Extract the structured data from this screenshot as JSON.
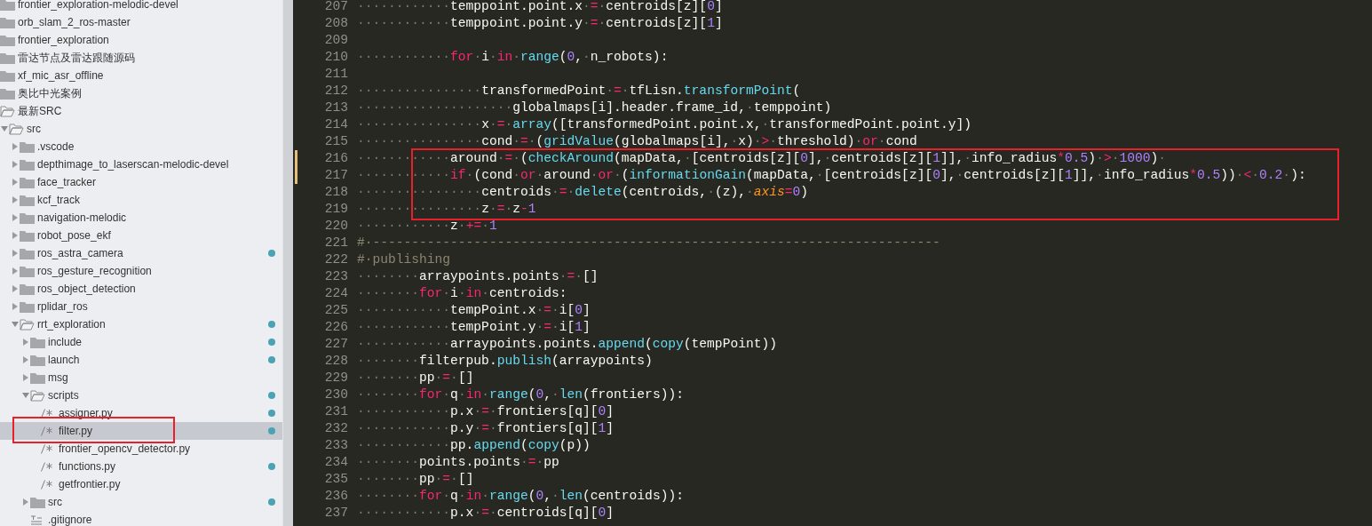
{
  "sidebar": {
    "items": [
      {
        "label": "frontier_exploration-melodic-devel",
        "kind": "folder",
        "expanded": false,
        "selected": false,
        "modified": false,
        "highlighted": false
      },
      {
        "label": "orb_slam_2_ros-master",
        "kind": "folder",
        "expanded": false,
        "selected": false,
        "modified": false,
        "highlighted": false
      },
      {
        "label": "frontier_exploration",
        "kind": "folder",
        "expanded": false,
        "selected": false,
        "modified": false,
        "highlighted": false
      },
      {
        "label": "雷达节点及雷达跟随源码",
        "kind": "folder",
        "expanded": false,
        "selected": false,
        "modified": false,
        "highlighted": false
      },
      {
        "label": "xf_mic_asr_offline",
        "kind": "folder",
        "expanded": false,
        "selected": false,
        "modified": false,
        "highlighted": false
      },
      {
        "label": "奥比中光案例",
        "kind": "folder",
        "expanded": false,
        "selected": false,
        "modified": false,
        "highlighted": false
      },
      {
        "label": "最新SRC",
        "kind": "folder",
        "expanded": true,
        "selected": false,
        "modified": false,
        "highlighted": false,
        "children": [
          {
            "label": "src",
            "kind": "folder",
            "expanded": true,
            "selected": false,
            "modified": false,
            "highlighted": false,
            "children": [
              {
                "label": ".vscode",
                "kind": "folder",
                "expanded": false,
                "selected": false,
                "modified": false,
                "highlighted": false
              },
              {
                "label": "depthimage_to_laserscan-melodic-devel",
                "kind": "folder",
                "expanded": false,
                "selected": false,
                "modified": false,
                "highlighted": false
              },
              {
                "label": "face_tracker",
                "kind": "folder",
                "expanded": false,
                "selected": false,
                "modified": false,
                "highlighted": false
              },
              {
                "label": "kcf_track",
                "kind": "folder",
                "expanded": false,
                "selected": false,
                "modified": false,
                "highlighted": false
              },
              {
                "label": "navigation-melodic",
                "kind": "folder",
                "expanded": false,
                "selected": false,
                "modified": false,
                "highlighted": false
              },
              {
                "label": "robot_pose_ekf",
                "kind": "folder",
                "expanded": false,
                "selected": false,
                "modified": false,
                "highlighted": false
              },
              {
                "label": "ros_astra_camera",
                "kind": "folder",
                "expanded": false,
                "selected": false,
                "modified": true,
                "highlighted": false
              },
              {
                "label": "ros_gesture_recognition",
                "kind": "folder",
                "expanded": false,
                "selected": false,
                "modified": false,
                "highlighted": false
              },
              {
                "label": "ros_object_detection",
                "kind": "folder",
                "expanded": false,
                "selected": false,
                "modified": false,
                "highlighted": false
              },
              {
                "label": "rplidar_ros",
                "kind": "folder",
                "expanded": false,
                "selected": false,
                "modified": false,
                "highlighted": false
              },
              {
                "label": "rrt_exploration",
                "kind": "folder",
                "expanded": true,
                "selected": false,
                "modified": true,
                "highlighted": false,
                "children": [
                  {
                    "label": "include",
                    "kind": "folder",
                    "expanded": false,
                    "selected": false,
                    "modified": true,
                    "highlighted": false
                  },
                  {
                    "label": "launch",
                    "kind": "folder",
                    "expanded": false,
                    "selected": false,
                    "modified": true,
                    "highlighted": false
                  },
                  {
                    "label": "msg",
                    "kind": "folder",
                    "expanded": false,
                    "selected": false,
                    "modified": false,
                    "highlighted": false
                  },
                  {
                    "label": "scripts",
                    "kind": "folder",
                    "expanded": true,
                    "selected": false,
                    "modified": true,
                    "highlighted": false,
                    "children": [
                      {
                        "label": "assigner.py",
                        "kind": "code",
                        "selected": false,
                        "modified": true,
                        "highlighted": false
                      },
                      {
                        "label": "filter.py",
                        "kind": "code",
                        "selected": true,
                        "modified": true,
                        "highlighted": true
                      },
                      {
                        "label": "frontier_opencv_detector.py",
                        "kind": "code",
                        "selected": false,
                        "modified": false,
                        "highlighted": false
                      },
                      {
                        "label": "functions.py",
                        "kind": "code",
                        "selected": false,
                        "modified": true,
                        "highlighted": false
                      },
                      {
                        "label": "getfrontier.py",
                        "kind": "code",
                        "selected": false,
                        "modified": false,
                        "highlighted": false
                      }
                    ]
                  },
                  {
                    "label": "src",
                    "kind": "folder",
                    "expanded": false,
                    "selected": false,
                    "modified": true,
                    "highlighted": false
                  },
                  {
                    "label": ".gitignore",
                    "kind": "text",
                    "selected": false,
                    "modified": false,
                    "highlighted": false
                  }
                ]
              }
            ]
          }
        ]
      }
    ]
  },
  "editor": {
    "lines": [
      {
        "number": "207",
        "modified": false,
        "highlighted": false,
        "tokens": [
          {
            "kind": "ws",
            "text": "············"
          },
          {
            "kind": "plain",
            "text": "temppoint.point.x"
          },
          {
            "kind": "ws",
            "text": "·"
          },
          {
            "kind": "kw",
            "text": "="
          },
          {
            "kind": "ws",
            "text": "·"
          },
          {
            "kind": "plain",
            "text": "centroids[z]["
          },
          {
            "kind": "num",
            "text": "0"
          },
          {
            "kind": "plain",
            "text": "]"
          }
        ]
      },
      {
        "number": "208",
        "modified": false,
        "highlighted": false,
        "tokens": [
          {
            "kind": "ws",
            "text": "············"
          },
          {
            "kind": "plain",
            "text": "temppoint.point.y"
          },
          {
            "kind": "ws",
            "text": "·"
          },
          {
            "kind": "kw",
            "text": "="
          },
          {
            "kind": "ws",
            "text": "·"
          },
          {
            "kind": "plain",
            "text": "centroids[z]["
          },
          {
            "kind": "num",
            "text": "1"
          },
          {
            "kind": "plain",
            "text": "]"
          }
        ]
      },
      {
        "number": "209",
        "modified": false,
        "highlighted": false
      },
      {
        "number": "210",
        "modified": false,
        "highlighted": false,
        "tokens": [
          {
            "kind": "ws",
            "text": "············"
          },
          {
            "kind": "kw",
            "text": "for"
          },
          {
            "kind": "ws",
            "text": "·"
          },
          {
            "kind": "plain",
            "text": "i"
          },
          {
            "kind": "ws",
            "text": "·"
          },
          {
            "kind": "kw",
            "text": "in"
          },
          {
            "kind": "ws",
            "text": "·"
          },
          {
            "kind": "fn",
            "text": "range"
          },
          {
            "kind": "plain",
            "text": "("
          },
          {
            "kind": "num",
            "text": "0"
          },
          {
            "kind": "plain",
            "text": ","
          },
          {
            "kind": "ws",
            "text": "·"
          },
          {
            "kind": "plain",
            "text": "n_robots):"
          }
        ]
      },
      {
        "number": "211",
        "modified": false,
        "highlighted": false
      },
      {
        "number": "212",
        "modified": false,
        "highlighted": false,
        "tokens": [
          {
            "kind": "ws",
            "text": "················"
          },
          {
            "kind": "plain",
            "text": "transformedPoint"
          },
          {
            "kind": "ws",
            "text": "·"
          },
          {
            "kind": "kw",
            "text": "="
          },
          {
            "kind": "ws",
            "text": "·"
          },
          {
            "kind": "plain",
            "text": "tfLisn."
          },
          {
            "kind": "fn",
            "text": "transformPoint"
          },
          {
            "kind": "plain",
            "text": "("
          }
        ]
      },
      {
        "number": "213",
        "modified": false,
        "highlighted": false,
        "tokens": [
          {
            "kind": "ws",
            "text": "····················"
          },
          {
            "kind": "plain",
            "text": "globalmaps[i].header.frame_id,"
          },
          {
            "kind": "ws",
            "text": "·"
          },
          {
            "kind": "plain",
            "text": "temppoint)"
          }
        ]
      },
      {
        "number": "214",
        "modified": false,
        "highlighted": false,
        "tokens": [
          {
            "kind": "ws",
            "text": "················"
          },
          {
            "kind": "plain",
            "text": "x"
          },
          {
            "kind": "ws",
            "text": "·"
          },
          {
            "kind": "kw",
            "text": "="
          },
          {
            "kind": "ws",
            "text": "·"
          },
          {
            "kind": "fn",
            "text": "array"
          },
          {
            "kind": "plain",
            "text": "([transformedPoint.point.x,"
          },
          {
            "kind": "ws",
            "text": "·"
          },
          {
            "kind": "plain",
            "text": "transformedPoint.point.y])"
          }
        ]
      },
      {
        "number": "215",
        "modified": false,
        "highlighted": false,
        "tokens": [
          {
            "kind": "ws",
            "text": "················"
          },
          {
            "kind": "plain",
            "text": "cond"
          },
          {
            "kind": "ws",
            "text": "·"
          },
          {
            "kind": "kw",
            "text": "="
          },
          {
            "kind": "ws",
            "text": "·"
          },
          {
            "kind": "plain",
            "text": "("
          },
          {
            "kind": "fn",
            "text": "gridValue"
          },
          {
            "kind": "plain",
            "text": "(globalmaps[i],"
          },
          {
            "kind": "ws",
            "text": "·"
          },
          {
            "kind": "plain",
            "text": "x)"
          },
          {
            "kind": "ws",
            "text": "·"
          },
          {
            "kind": "kw",
            "text": ">"
          },
          {
            "kind": "ws",
            "text": "·"
          },
          {
            "kind": "plain",
            "text": "threshold)"
          },
          {
            "kind": "ws",
            "text": "·"
          },
          {
            "kind": "kw",
            "text": "or"
          },
          {
            "kind": "ws",
            "text": "·"
          },
          {
            "kind": "plain",
            "text": "cond"
          }
        ]
      },
      {
        "number": "216",
        "modified": true,
        "highlighted": true,
        "tokens": [
          {
            "kind": "ws",
            "text": "············"
          },
          {
            "kind": "plain",
            "text": "around"
          },
          {
            "kind": "ws",
            "text": "·"
          },
          {
            "kind": "kw",
            "text": "="
          },
          {
            "kind": "ws",
            "text": "·"
          },
          {
            "kind": "plain",
            "text": "("
          },
          {
            "kind": "fn",
            "text": "checkAround"
          },
          {
            "kind": "plain",
            "text": "(mapData,"
          },
          {
            "kind": "ws",
            "text": "·"
          },
          {
            "kind": "plain",
            "text": "[centroids[z]["
          },
          {
            "kind": "num",
            "text": "0"
          },
          {
            "kind": "plain",
            "text": "],"
          },
          {
            "kind": "ws",
            "text": "·"
          },
          {
            "kind": "plain",
            "text": "centroids[z]["
          },
          {
            "kind": "num",
            "text": "1"
          },
          {
            "kind": "plain",
            "text": "]],"
          },
          {
            "kind": "ws",
            "text": "·"
          },
          {
            "kind": "plain",
            "text": "info_radius"
          },
          {
            "kind": "kw",
            "text": "*"
          },
          {
            "kind": "num",
            "text": "0.5"
          },
          {
            "kind": "plain",
            "text": ")"
          },
          {
            "kind": "ws",
            "text": "·"
          },
          {
            "kind": "kw",
            "text": ">"
          },
          {
            "kind": "ws",
            "text": "·"
          },
          {
            "kind": "num",
            "text": "1000"
          },
          {
            "kind": "plain",
            "text": ")"
          },
          {
            "kind": "ws",
            "text": "·"
          }
        ]
      },
      {
        "number": "217",
        "modified": true,
        "highlighted": true,
        "tokens": [
          {
            "kind": "ws",
            "text": "············"
          },
          {
            "kind": "kw",
            "text": "if"
          },
          {
            "kind": "ws",
            "text": "·"
          },
          {
            "kind": "plain",
            "text": "(cond"
          },
          {
            "kind": "ws",
            "text": "·"
          },
          {
            "kind": "kw",
            "text": "or"
          },
          {
            "kind": "ws",
            "text": "·"
          },
          {
            "kind": "plain",
            "text": "around"
          },
          {
            "kind": "ws",
            "text": "·"
          },
          {
            "kind": "kw",
            "text": "or"
          },
          {
            "kind": "ws",
            "text": "·"
          },
          {
            "kind": "plain",
            "text": "("
          },
          {
            "kind": "fn",
            "text": "informationGain"
          },
          {
            "kind": "plain",
            "text": "(mapData,"
          },
          {
            "kind": "ws",
            "text": "·"
          },
          {
            "kind": "plain",
            "text": "[centroids[z]["
          },
          {
            "kind": "num",
            "text": "0"
          },
          {
            "kind": "plain",
            "text": "],"
          },
          {
            "kind": "ws",
            "text": "·"
          },
          {
            "kind": "plain",
            "text": "centroids[z]["
          },
          {
            "kind": "num",
            "text": "1"
          },
          {
            "kind": "plain",
            "text": "]],"
          },
          {
            "kind": "ws",
            "text": "·"
          },
          {
            "kind": "plain",
            "text": "info_radius"
          },
          {
            "kind": "kw",
            "text": "*"
          },
          {
            "kind": "num",
            "text": "0.5"
          },
          {
            "kind": "plain",
            "text": "))"
          },
          {
            "kind": "ws",
            "text": "·"
          },
          {
            "kind": "kw",
            "text": "<"
          },
          {
            "kind": "ws",
            "text": "·"
          },
          {
            "kind": "num",
            "text": "0.2"
          },
          {
            "kind": "ws",
            "text": "·"
          },
          {
            "kind": "plain",
            "text": "):"
          }
        ]
      },
      {
        "number": "218",
        "modified": false,
        "highlighted": true,
        "tokens": [
          {
            "kind": "ws",
            "text": "················"
          },
          {
            "kind": "plain",
            "text": "centroids"
          },
          {
            "kind": "ws",
            "text": "·"
          },
          {
            "kind": "kw",
            "text": "="
          },
          {
            "kind": "ws",
            "text": "·"
          },
          {
            "kind": "fn",
            "text": "delete"
          },
          {
            "kind": "plain",
            "text": "(centroids,"
          },
          {
            "kind": "ws",
            "text": "·"
          },
          {
            "kind": "plain",
            "text": "(z),"
          },
          {
            "kind": "ws",
            "text": "·"
          },
          {
            "kind": "param",
            "text": "axis"
          },
          {
            "kind": "kw",
            "text": "="
          },
          {
            "kind": "num",
            "text": "0"
          },
          {
            "kind": "plain",
            "text": ")"
          }
        ]
      },
      {
        "number": "219",
        "modified": false,
        "highlighted": true,
        "tokens": [
          {
            "kind": "ws",
            "text": "················"
          },
          {
            "kind": "plain",
            "text": "z"
          },
          {
            "kind": "ws",
            "text": "·"
          },
          {
            "kind": "kw",
            "text": "="
          },
          {
            "kind": "ws",
            "text": "·"
          },
          {
            "kind": "plain",
            "text": "z"
          },
          {
            "kind": "kw",
            "text": "-"
          },
          {
            "kind": "num",
            "text": "1"
          }
        ]
      },
      {
        "number": "220",
        "modified": false,
        "highlighted": false,
        "tokens": [
          {
            "kind": "ws",
            "text": "············"
          },
          {
            "kind": "plain",
            "text": "z"
          },
          {
            "kind": "ws",
            "text": "·"
          },
          {
            "kind": "kw",
            "text": "+="
          },
          {
            "kind": "ws",
            "text": "·"
          },
          {
            "kind": "num",
            "text": "1"
          }
        ]
      },
      {
        "number": "221",
        "modified": false,
        "highlighted": false,
        "tokens": [
          {
            "kind": "comment",
            "text": "#·-------------------------------------------------------------------------"
          }
        ]
      },
      {
        "number": "222",
        "modified": false,
        "highlighted": false,
        "tokens": [
          {
            "kind": "comment",
            "text": "#·publishing"
          }
        ]
      },
      {
        "number": "223",
        "modified": false,
        "highlighted": false,
        "tokens": [
          {
            "kind": "ws",
            "text": "········"
          },
          {
            "kind": "plain",
            "text": "arraypoints.points"
          },
          {
            "kind": "ws",
            "text": "·"
          },
          {
            "kind": "kw",
            "text": "="
          },
          {
            "kind": "ws",
            "text": "·"
          },
          {
            "kind": "plain",
            "text": "[]"
          }
        ]
      },
      {
        "number": "224",
        "modified": false,
        "highlighted": false,
        "tokens": [
          {
            "kind": "ws",
            "text": "········"
          },
          {
            "kind": "kw",
            "text": "for"
          },
          {
            "kind": "ws",
            "text": "·"
          },
          {
            "kind": "plain",
            "text": "i"
          },
          {
            "kind": "ws",
            "text": "·"
          },
          {
            "kind": "kw",
            "text": "in"
          },
          {
            "kind": "ws",
            "text": "·"
          },
          {
            "kind": "plain",
            "text": "centroids:"
          }
        ]
      },
      {
        "number": "225",
        "modified": false,
        "highlighted": false,
        "tokens": [
          {
            "kind": "ws",
            "text": "············"
          },
          {
            "kind": "plain",
            "text": "tempPoint.x"
          },
          {
            "kind": "ws",
            "text": "·"
          },
          {
            "kind": "kw",
            "text": "="
          },
          {
            "kind": "ws",
            "text": "·"
          },
          {
            "kind": "plain",
            "text": "i["
          },
          {
            "kind": "num",
            "text": "0"
          },
          {
            "kind": "plain",
            "text": "]"
          }
        ]
      },
      {
        "number": "226",
        "modified": false,
        "highlighted": false,
        "tokens": [
          {
            "kind": "ws",
            "text": "············"
          },
          {
            "kind": "plain",
            "text": "tempPoint.y"
          },
          {
            "kind": "ws",
            "text": "·"
          },
          {
            "kind": "kw",
            "text": "="
          },
          {
            "kind": "ws",
            "text": "·"
          },
          {
            "kind": "plain",
            "text": "i["
          },
          {
            "kind": "num",
            "text": "1"
          },
          {
            "kind": "plain",
            "text": "]"
          }
        ]
      },
      {
        "number": "227",
        "modified": false,
        "highlighted": false,
        "tokens": [
          {
            "kind": "ws",
            "text": "············"
          },
          {
            "kind": "plain",
            "text": "arraypoints.points."
          },
          {
            "kind": "fn",
            "text": "append"
          },
          {
            "kind": "plain",
            "text": "("
          },
          {
            "kind": "fn",
            "text": "copy"
          },
          {
            "kind": "plain",
            "text": "(tempPoint))"
          }
        ]
      },
      {
        "number": "228",
        "modified": false,
        "highlighted": false,
        "tokens": [
          {
            "kind": "ws",
            "text": "········"
          },
          {
            "kind": "plain",
            "text": "filterpub."
          },
          {
            "kind": "fn",
            "text": "publish"
          },
          {
            "kind": "plain",
            "text": "(arraypoints)"
          }
        ]
      },
      {
        "number": "229",
        "modified": false,
        "highlighted": false,
        "tokens": [
          {
            "kind": "ws",
            "text": "········"
          },
          {
            "kind": "plain",
            "text": "pp"
          },
          {
            "kind": "ws",
            "text": "·"
          },
          {
            "kind": "kw",
            "text": "="
          },
          {
            "kind": "ws",
            "text": "·"
          },
          {
            "kind": "plain",
            "text": "[]"
          }
        ]
      },
      {
        "number": "230",
        "modified": false,
        "highlighted": false,
        "tokens": [
          {
            "kind": "ws",
            "text": "········"
          },
          {
            "kind": "kw",
            "text": "for"
          },
          {
            "kind": "ws",
            "text": "·"
          },
          {
            "kind": "plain",
            "text": "q"
          },
          {
            "kind": "ws",
            "text": "·"
          },
          {
            "kind": "kw",
            "text": "in"
          },
          {
            "kind": "ws",
            "text": "·"
          },
          {
            "kind": "fn",
            "text": "range"
          },
          {
            "kind": "plain",
            "text": "("
          },
          {
            "kind": "num",
            "text": "0"
          },
          {
            "kind": "plain",
            "text": ","
          },
          {
            "kind": "ws",
            "text": "·"
          },
          {
            "kind": "fn",
            "text": "len"
          },
          {
            "kind": "plain",
            "text": "(frontiers)):"
          }
        ]
      },
      {
        "number": "231",
        "modified": false,
        "highlighted": false,
        "tokens": [
          {
            "kind": "ws",
            "text": "············"
          },
          {
            "kind": "plain",
            "text": "p.x"
          },
          {
            "kind": "ws",
            "text": "·"
          },
          {
            "kind": "kw",
            "text": "="
          },
          {
            "kind": "ws",
            "text": "·"
          },
          {
            "kind": "plain",
            "text": "frontiers[q]["
          },
          {
            "kind": "num",
            "text": "0"
          },
          {
            "kind": "plain",
            "text": "]"
          }
        ]
      },
      {
        "number": "232",
        "modified": false,
        "highlighted": false,
        "tokens": [
          {
            "kind": "ws",
            "text": "············"
          },
          {
            "kind": "plain",
            "text": "p.y"
          },
          {
            "kind": "ws",
            "text": "·"
          },
          {
            "kind": "kw",
            "text": "="
          },
          {
            "kind": "ws",
            "text": "·"
          },
          {
            "kind": "plain",
            "text": "frontiers[q]["
          },
          {
            "kind": "num",
            "text": "1"
          },
          {
            "kind": "plain",
            "text": "]"
          }
        ]
      },
      {
        "number": "233",
        "modified": false,
        "highlighted": false,
        "tokens": [
          {
            "kind": "ws",
            "text": "············"
          },
          {
            "kind": "plain",
            "text": "pp."
          },
          {
            "kind": "fn",
            "text": "append"
          },
          {
            "kind": "plain",
            "text": "("
          },
          {
            "kind": "fn",
            "text": "copy"
          },
          {
            "kind": "plain",
            "text": "(p))"
          }
        ]
      },
      {
        "number": "234",
        "modified": false,
        "highlighted": false,
        "tokens": [
          {
            "kind": "ws",
            "text": "········"
          },
          {
            "kind": "plain",
            "text": "points.points"
          },
          {
            "kind": "ws",
            "text": "·"
          },
          {
            "kind": "kw",
            "text": "="
          },
          {
            "kind": "ws",
            "text": "·"
          },
          {
            "kind": "plain",
            "text": "pp"
          }
        ]
      },
      {
        "number": "235",
        "modified": false,
        "highlighted": false,
        "tokens": [
          {
            "kind": "ws",
            "text": "········"
          },
          {
            "kind": "plain",
            "text": "pp"
          },
          {
            "kind": "ws",
            "text": "·"
          },
          {
            "kind": "kw",
            "text": "="
          },
          {
            "kind": "ws",
            "text": "·"
          },
          {
            "kind": "plain",
            "text": "[]"
          }
        ]
      },
      {
        "number": "236",
        "modified": false,
        "highlighted": false,
        "tokens": [
          {
            "kind": "ws",
            "text": "········"
          },
          {
            "kind": "kw",
            "text": "for"
          },
          {
            "kind": "ws",
            "text": "·"
          },
          {
            "kind": "plain",
            "text": "q"
          },
          {
            "kind": "ws",
            "text": "·"
          },
          {
            "kind": "kw",
            "text": "in"
          },
          {
            "kind": "ws",
            "text": "·"
          },
          {
            "kind": "fn",
            "text": "range"
          },
          {
            "kind": "plain",
            "text": "("
          },
          {
            "kind": "num",
            "text": "0"
          },
          {
            "kind": "plain",
            "text": ","
          },
          {
            "kind": "ws",
            "text": "·"
          },
          {
            "kind": "fn",
            "text": "len"
          },
          {
            "kind": "plain",
            "text": "(centroids)):"
          }
        ]
      },
      {
        "number": "237",
        "modified": false,
        "highlighted": false,
        "tokens": [
          {
            "kind": "ws",
            "text": "············"
          },
          {
            "kind": "plain",
            "text": "p.x"
          },
          {
            "kind": "ws",
            "text": "·"
          },
          {
            "kind": "kw",
            "text": "="
          },
          {
            "kind": "ws",
            "text": "·"
          },
          {
            "kind": "plain",
            "text": "centroids[q]["
          },
          {
            "kind": "num",
            "text": "0"
          },
          {
            "kind": "plain",
            "text": "]"
          }
        ]
      }
    ]
  }
}
